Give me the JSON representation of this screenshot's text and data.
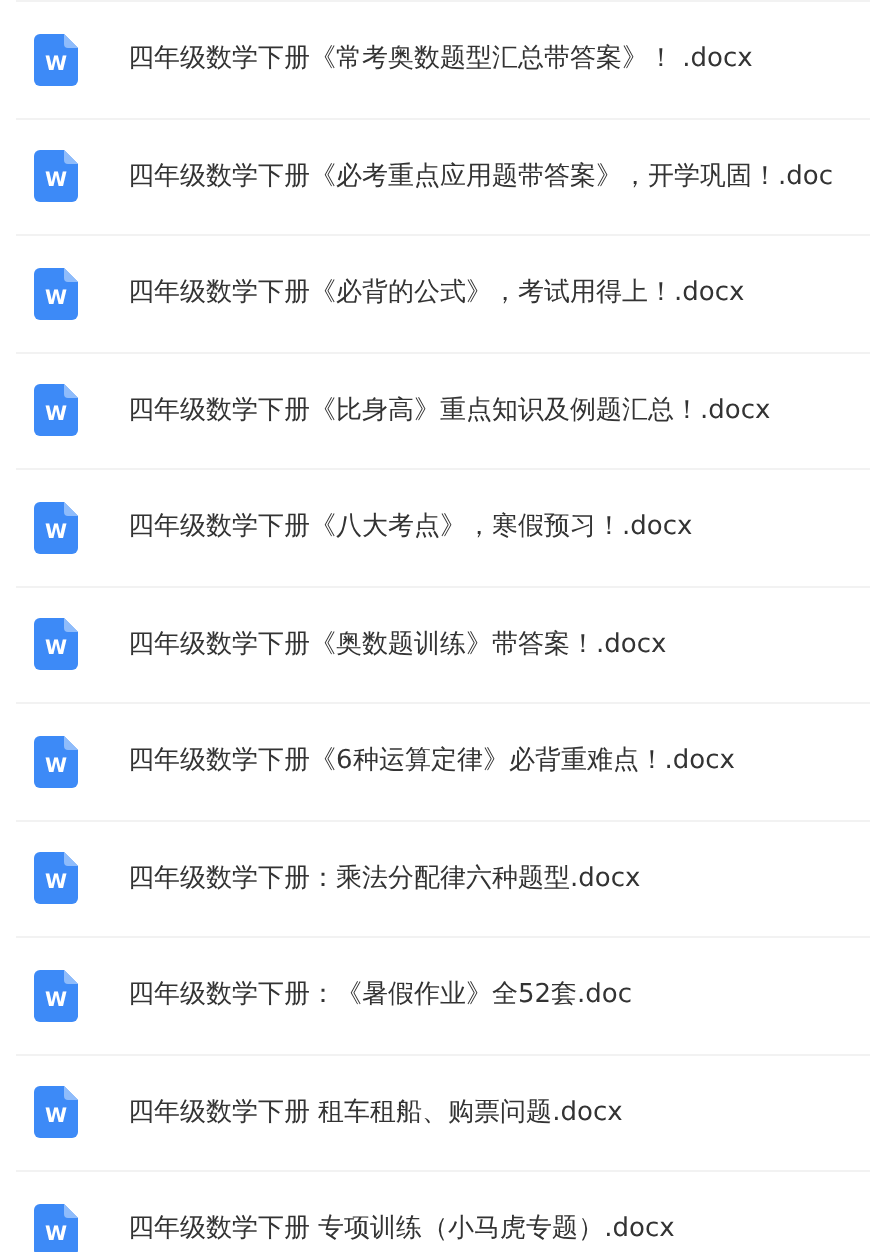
{
  "files": [
    {
      "name": "四年级数学下册《常考奥数题型汇总带答案》！ .docx",
      "icon_label": "W"
    },
    {
      "name": "四年级数学下册《必考重点应用题带答案》，开学巩固！.doc",
      "icon_label": "W"
    },
    {
      "name": "四年级数学下册《必背的公式》，考试用得上！.docx",
      "icon_label": "W"
    },
    {
      "name": "四年级数学下册《比身高》重点知识及例题汇总！.docx",
      "icon_label": "W"
    },
    {
      "name": "四年级数学下册《八大考点》，寒假预习！.docx",
      "icon_label": "W"
    },
    {
      "name": "四年级数学下册《奥数题训练》带答案！.docx",
      "icon_label": "W"
    },
    {
      "name": "四年级数学下册《6种运算定律》必背重难点！.docx",
      "icon_label": "W"
    },
    {
      "name": "四年级数学下册：乘法分配律六种题型.docx",
      "icon_label": "W"
    },
    {
      "name": "四年级数学下册：《暑假作业》全52套.doc",
      "icon_label": "W"
    },
    {
      "name": "四年级数学下册 租车租船、购票问题.docx",
      "icon_label": "W"
    },
    {
      "name": "四年级数学下册 专项训练（小马虎专题）.docx",
      "icon_label": "W"
    }
  ]
}
